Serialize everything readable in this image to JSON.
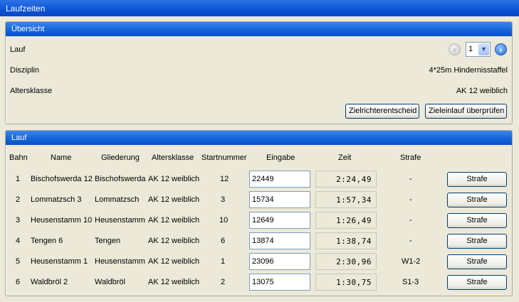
{
  "window": {
    "title": "Laufzeiten"
  },
  "overview": {
    "header": "Übersicht",
    "rows": [
      {
        "label": "Lauf"
      },
      {
        "label": "Disziplin",
        "value": "4*25m Hindernisstaffel"
      },
      {
        "label": "Altersklasse",
        "value": "AK 12 weiblich"
      }
    ],
    "lauf_select": "1",
    "buttons": {
      "zielrichter": "Zielrichterentscheid",
      "zieleinlauf": "Zieleinlauf überprüfen"
    },
    "icons": {
      "prev": "arrow-left-icon",
      "next": "arrow-right-icon",
      "dropdown": "chevron-down-icon"
    }
  },
  "lauf": {
    "header": "Lauf",
    "columns": [
      "Bahn",
      "Name",
      "Gliederung",
      "Altersklasse",
      "Startnummer",
      "Eingabe",
      "Zeit",
      "Strafe"
    ],
    "rows": [
      {
        "bahn": "1",
        "name": "Bischofswerda 12",
        "gliederung": "Bischofswerda",
        "altersklasse": "AK 12 weiblich",
        "startnummer": "12",
        "eingabe": "22449",
        "zeit": "2:24,49",
        "strafe": "-",
        "button": "Strafe"
      },
      {
        "bahn": "2",
        "name": "Lommatzsch 3",
        "gliederung": "Lommatzsch",
        "altersklasse": "AK 12 weiblich",
        "startnummer": "3",
        "eingabe": "15734",
        "zeit": "1:57,34",
        "strafe": "-",
        "button": "Strafe"
      },
      {
        "bahn": "3",
        "name": "Heusenstamm 10",
        "gliederung": "Heusenstamm",
        "altersklasse": "AK 12 weiblich",
        "startnummer": "10",
        "eingabe": "12649",
        "zeit": "1:26,49",
        "strafe": "-",
        "button": "Strafe"
      },
      {
        "bahn": "4",
        "name": "Tengen 6",
        "gliederung": "Tengen",
        "altersklasse": "AK 12 weiblich",
        "startnummer": "6",
        "eingabe": "13874",
        "zeit": "1:38,74",
        "strafe": "-",
        "button": "Strafe"
      },
      {
        "bahn": "5",
        "name": "Heusenstamm 1",
        "gliederung": "Heusenstamm",
        "altersklasse": "AK 12 weiblich",
        "startnummer": "1",
        "eingabe": "23096",
        "zeit": "2:30,96",
        "strafe": "W1-2",
        "button": "Strafe"
      },
      {
        "bahn": "6",
        "name": "Waldbröl 2",
        "gliederung": "Waldbröl",
        "altersklasse": "AK 12 weiblich",
        "startnummer": "2",
        "eingabe": "13075",
        "zeit": "1:30,75",
        "strafe": "S1-3",
        "button": "Strafe"
      }
    ]
  }
}
